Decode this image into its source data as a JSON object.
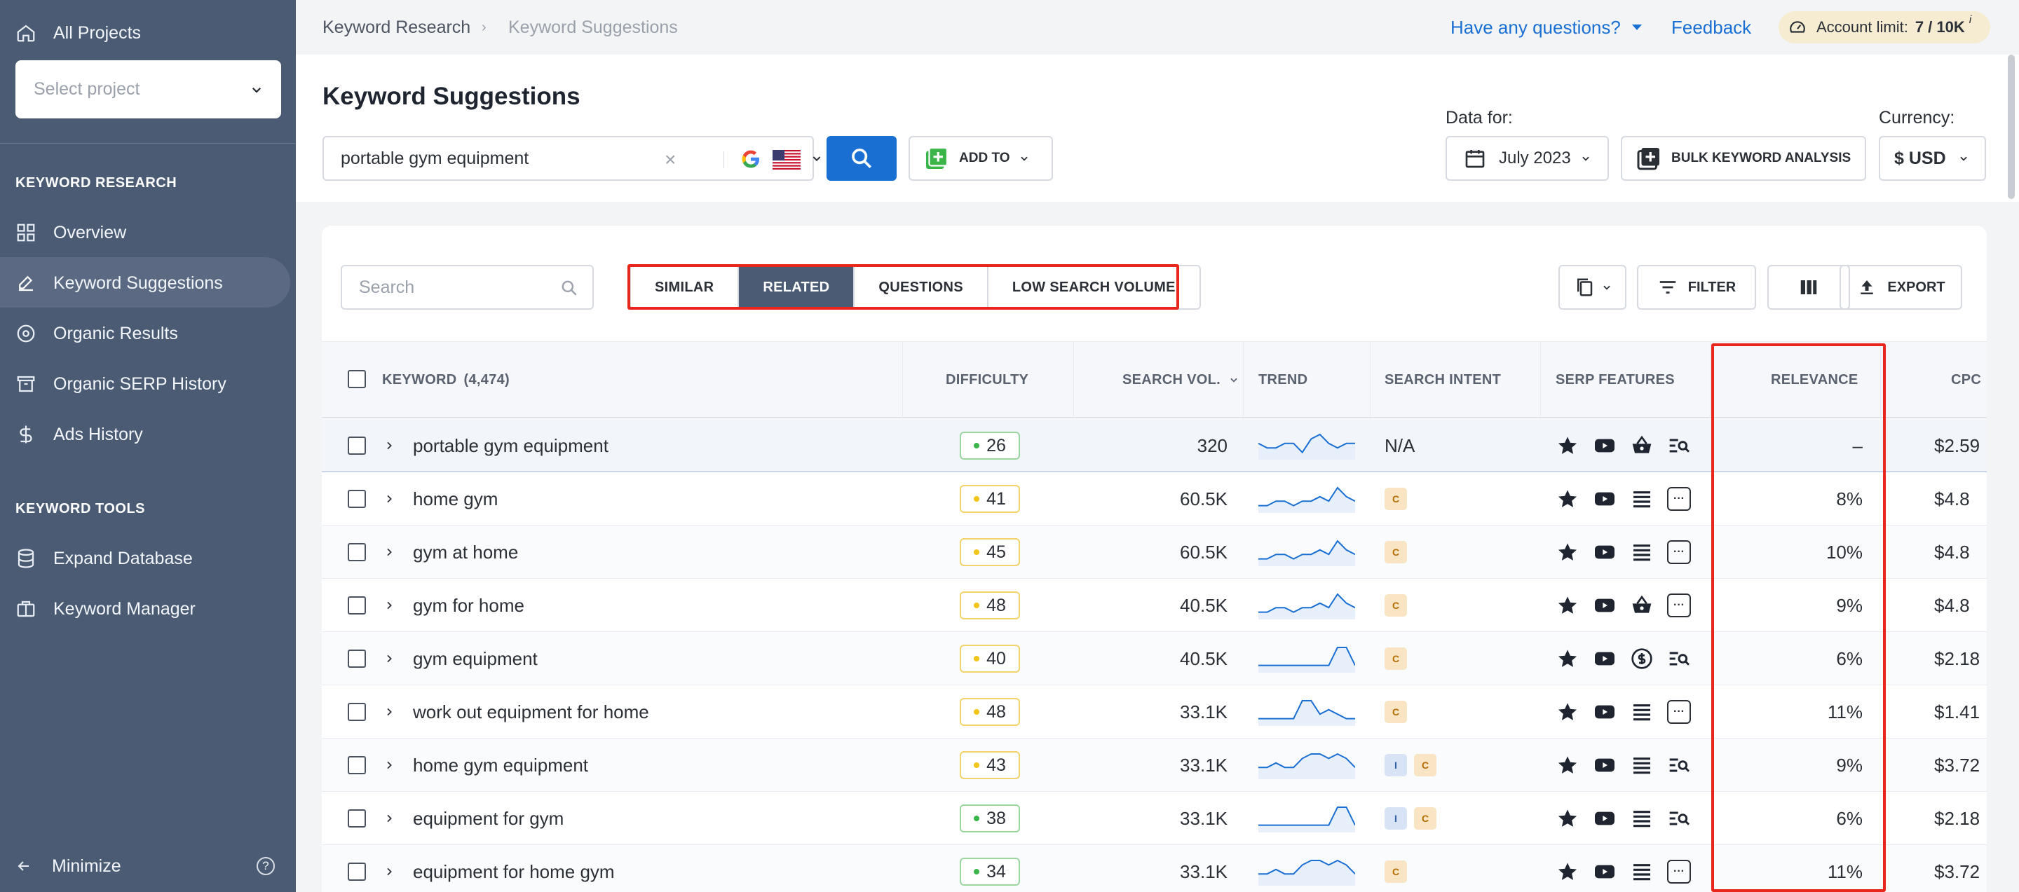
{
  "sidebar": {
    "all_projects": "All Projects",
    "select_project": "Select project",
    "section_research": "KEYWORD RESEARCH",
    "research_items": [
      {
        "label": "Overview",
        "icon": "grid-icon"
      },
      {
        "label": "Keyword Suggestions",
        "icon": "pencil-icon",
        "active": true
      },
      {
        "label": "Organic Results",
        "icon": "target-icon"
      },
      {
        "label": "Organic SERP History",
        "icon": "archive-icon"
      },
      {
        "label": "Ads History",
        "icon": "dollar-icon"
      }
    ],
    "section_tools": "KEYWORD TOOLS",
    "tools_items": [
      {
        "label": "Expand Database",
        "icon": "database-icon"
      },
      {
        "label": "Keyword Manager",
        "icon": "briefcase-icon"
      }
    ],
    "minimize": "Minimize",
    "help": "?"
  },
  "topbar": {
    "breadcrumb": [
      "Keyword Research",
      "Keyword Suggestions"
    ],
    "separator": "›",
    "questions": "Have any questions?",
    "feedback": "Feedback",
    "account_label": "Account limit:",
    "account_value": "7 / 10K",
    "account_info": "i"
  },
  "header": {
    "title": "Keyword Suggestions",
    "keyword": "portable gym equipment",
    "clear": "×",
    "add_to": "ADD TO",
    "data_for_label": "Data for:",
    "month": "July 2023",
    "bulk": "BULK KEYWORD ANALYSIS",
    "currency_label": "Currency:",
    "currency": "$ USD"
  },
  "toolbar": {
    "search_placeholder": "Search",
    "tabs": [
      "SIMILAR",
      "RELATED",
      "QUESTIONS",
      "LOW SEARCH VOLUME"
    ],
    "active_tab": "RELATED",
    "filter": "FILTER",
    "export": "EXPORT"
  },
  "table": {
    "columns": {
      "keyword": "KEYWORD",
      "keyword_count": "(4,474)",
      "difficulty": "DIFFICULTY",
      "search_vol": "SEARCH VOL.",
      "trend": "TREND",
      "search_intent": "SEARCH INTENT",
      "serp_features": "SERP FEATURES",
      "relevance": "RELEVANCE",
      "cpc": "CPC"
    },
    "rows": [
      {
        "keyword": "portable gym equipment",
        "difficulty": "26",
        "diff_level": "green",
        "volume": "320",
        "trend": [
          3,
          2,
          2,
          3,
          3,
          1,
          4,
          5,
          3,
          2,
          3,
          3
        ],
        "intent": "N/A",
        "serp": [
          "star-icon",
          "video-icon",
          "shopping-icon",
          "search-list-icon"
        ],
        "relevance": "–",
        "cpc": "$2.59"
      },
      {
        "keyword": "home gym",
        "difficulty": "41",
        "diff_level": "yellow",
        "volume": "60.5K",
        "trend": [
          1,
          1,
          2,
          2,
          1,
          2,
          2,
          3,
          2,
          5,
          3,
          2
        ],
        "intent": [
          "C"
        ],
        "serp": [
          "star-icon",
          "video-icon",
          "list-icon",
          "more"
        ],
        "relevance": "8%",
        "cpc": "$4.8"
      },
      {
        "keyword": "gym at home",
        "difficulty": "45",
        "diff_level": "yellow",
        "volume": "60.5K",
        "trend": [
          1,
          1,
          2,
          2,
          1,
          2,
          2,
          3,
          2,
          5,
          3,
          2
        ],
        "intent": [
          "C"
        ],
        "serp": [
          "star-icon",
          "video-icon",
          "list-icon",
          "more"
        ],
        "relevance": "10%",
        "cpc": "$4.8"
      },
      {
        "keyword": "gym for home",
        "difficulty": "48",
        "diff_level": "yellow",
        "volume": "40.5K",
        "trend": [
          1,
          1,
          2,
          2,
          1,
          2,
          2,
          3,
          2,
          5,
          3,
          2
        ],
        "intent": [
          "C"
        ],
        "serp": [
          "star-icon",
          "video-icon",
          "shopping-icon",
          "more"
        ],
        "relevance": "9%",
        "cpc": "$4.8"
      },
      {
        "keyword": "gym equipment",
        "difficulty": "40",
        "diff_level": "yellow",
        "volume": "40.5K",
        "trend": [
          1,
          1,
          1,
          1,
          1,
          1,
          1,
          1,
          1,
          5,
          5,
          1
        ],
        "intent": [
          "C"
        ],
        "serp": [
          "star-icon",
          "video-icon",
          "dollar-circle-icon",
          "search-list-icon"
        ],
        "relevance": "6%",
        "cpc": "$2.18"
      },
      {
        "keyword": "work out equipment for home",
        "difficulty": "48",
        "diff_level": "yellow",
        "volume": "33.1K",
        "trend": [
          1,
          1,
          1,
          1,
          1,
          5,
          5,
          2,
          3,
          2,
          1,
          1
        ],
        "intent": [
          "C"
        ],
        "serp": [
          "star-icon",
          "video-icon",
          "list-icon",
          "more"
        ],
        "relevance": "11%",
        "cpc": "$1.41"
      },
      {
        "keyword": "home gym equipment",
        "difficulty": "43",
        "diff_level": "yellow",
        "volume": "33.1K",
        "trend": [
          2,
          2,
          3,
          2,
          2,
          4,
          5,
          5,
          4,
          5,
          4,
          2
        ],
        "intent": [
          "I",
          "C"
        ],
        "serp": [
          "star-icon",
          "video-icon",
          "list-icon",
          "search-list-icon"
        ],
        "relevance": "9%",
        "cpc": "$3.72"
      },
      {
        "keyword": "equipment for gym",
        "difficulty": "38",
        "diff_level": "green",
        "volume": "33.1K",
        "trend": [
          1,
          1,
          1,
          1,
          1,
          1,
          1,
          1,
          1,
          5,
          5,
          1
        ],
        "intent": [
          "I",
          "C"
        ],
        "serp": [
          "star-icon",
          "video-icon",
          "list-icon",
          "search-list-icon"
        ],
        "relevance": "6%",
        "cpc": "$2.18"
      },
      {
        "keyword": "equipment for home gym",
        "difficulty": "34",
        "diff_level": "green",
        "volume": "33.1K",
        "trend": [
          2,
          2,
          3,
          2,
          2,
          4,
          5,
          5,
          4,
          5,
          4,
          2
        ],
        "intent": [
          "C"
        ],
        "serp": [
          "star-icon",
          "video-icon",
          "list-icon",
          "more"
        ],
        "relevance": "11%",
        "cpc": "$3.72"
      }
    ]
  },
  "colors": {
    "sidebar_bg": "#4b5b74",
    "accent_blue": "#1a6fd3",
    "highlight_red": "#e8261b",
    "diff_green": "#3bb54a",
    "diff_yellow": "#f0c419",
    "trend_line": "#1a6fd3"
  }
}
